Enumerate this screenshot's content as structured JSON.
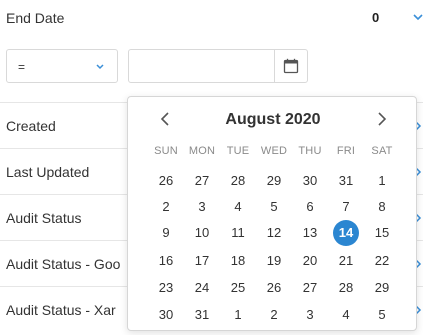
{
  "filter": {
    "title": "End Date",
    "count": "0",
    "operator": "=",
    "date_value": "",
    "date_placeholder": ""
  },
  "rows": [
    {
      "label": "Created"
    },
    {
      "label": "Last Updated"
    },
    {
      "label": "Audit Status"
    },
    {
      "label": "Audit Status - Goo"
    },
    {
      "label": "Audit Status - Xar"
    }
  ],
  "calendar": {
    "month_label": "August 2020",
    "weekdays": [
      "SUN",
      "MON",
      "TUE",
      "WED",
      "THU",
      "FRI",
      "SAT"
    ],
    "weeks": [
      [
        "26",
        "27",
        "28",
        "29",
        "30",
        "31",
        "1"
      ],
      [
        "2",
        "3",
        "4",
        "5",
        "6",
        "7",
        "8"
      ],
      [
        "9",
        "10",
        "11",
        "12",
        "13",
        "14",
        "15"
      ],
      [
        "16",
        "17",
        "18",
        "19",
        "20",
        "21",
        "22"
      ],
      [
        "23",
        "24",
        "25",
        "26",
        "27",
        "28",
        "29"
      ],
      [
        "30",
        "31",
        "1",
        "2",
        "3",
        "4",
        "5"
      ]
    ],
    "selected_day": "14",
    "accent_color": "#2b86d1"
  },
  "icons": {
    "header_toggle": "chevron-down-icon",
    "operator_caret": "chevron-down-icon",
    "calendar_button": "calendar-icon",
    "row_expand": "chevron-right-icon",
    "prev_month": "chevron-left-icon",
    "next_month": "chevron-right-icon"
  },
  "colors": {
    "chevron": "#3a8fd8",
    "text": "#333333",
    "border": "#d9d9d9"
  }
}
